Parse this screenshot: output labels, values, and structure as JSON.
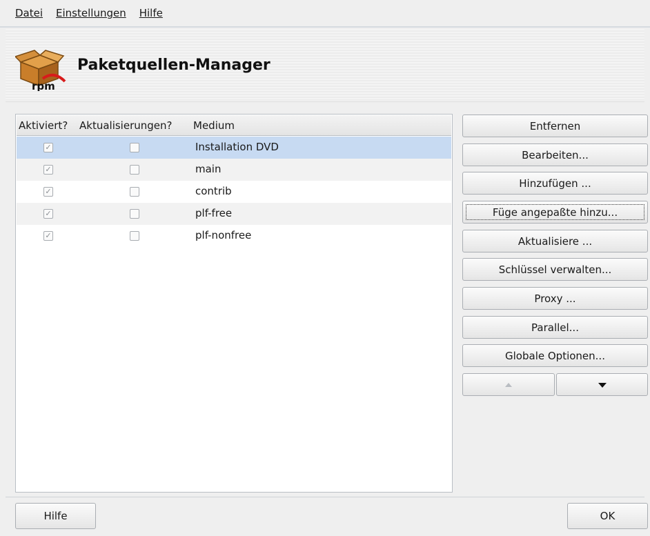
{
  "menu": {
    "items": [
      {
        "label": "Datei"
      },
      {
        "label": "Einstellungen"
      },
      {
        "label": "Hilfe"
      }
    ]
  },
  "header": {
    "title": "Paketquellen-Manager",
    "icon": "rpm-package-icon",
    "icon_text": "rpm"
  },
  "list": {
    "columns": [
      "Aktiviert?",
      "Aktualisierungen?",
      "Medium"
    ],
    "rows": [
      {
        "enabled": true,
        "updates": false,
        "medium": "Installation DVD",
        "selected": true
      },
      {
        "enabled": true,
        "updates": false,
        "medium": "main",
        "selected": false
      },
      {
        "enabled": true,
        "updates": false,
        "medium": "contrib",
        "selected": false
      },
      {
        "enabled": true,
        "updates": false,
        "medium": "plf-free",
        "selected": false
      },
      {
        "enabled": true,
        "updates": false,
        "medium": "plf-nonfree",
        "selected": false
      }
    ]
  },
  "buttons": {
    "remove": "Entfernen",
    "edit": "Bearbeiten...",
    "add": "Hinzufügen ...",
    "add_custom": "Füge angepaßte hinzu...",
    "update": "Aktualisiere ...",
    "keys": "Schlüssel verwalten...",
    "proxy": "Proxy ...",
    "parallel": "Parallel...",
    "global_options": "Globale Optionen...",
    "move_up_icon": "up-arrow-icon",
    "move_down_icon": "down-arrow-icon"
  },
  "footer": {
    "help": "Hilfe",
    "ok": "OK"
  },
  "colors": {
    "selection": "#c7daf2",
    "background": "#efefef"
  }
}
